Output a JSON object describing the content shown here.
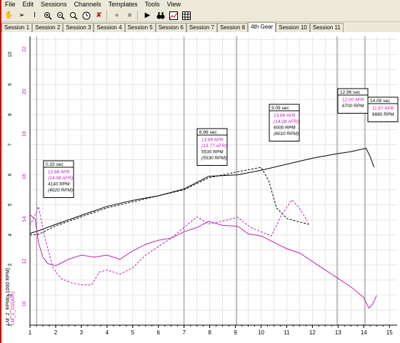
{
  "menu": [
    "File",
    "Edit",
    "Sessions",
    "Channels",
    "Templates",
    "Tools",
    "View"
  ],
  "toolbar": {
    "icons": [
      "hand-icon",
      "cursor-icon",
      "text-cursor-icon",
      "zoom-in-icon",
      "zoom-out-icon",
      "zoom-reset-icon",
      "clock-icon",
      "overlay-icon",
      "record-icon",
      "stop-icon",
      "play-icon",
      "binoculars-icon",
      "chart-icon",
      "grid-icon"
    ]
  },
  "tabs": [
    "Session 1",
    "Session 2",
    "Session 3",
    "Session 4",
    "Session 5",
    "Session 6",
    "Session 7",
    "Session 8",
    "4th Gear",
    "Session 10",
    "Session 11"
  ],
  "active_tab": "4th Gear",
  "colors": {
    "rpm": "#000000",
    "afr": "#c020b8",
    "grid": "#e4e4e4",
    "gridMajor": "#8c8c8c"
  },
  "chart_data": {
    "type": "line",
    "xlabel": "",
    "xlim": [
      1,
      15.3
    ],
    "x_ticks": [
      "1",
      "2",
      "3",
      "4",
      "5",
      "6",
      "7",
      "8",
      "9",
      "10",
      "11",
      "12",
      "13",
      "14",
      "15"
    ],
    "y_axis_labels": [
      "LM_2_RPM(x 1000 RPM)",
      "LM_2_O2(A/R)"
    ],
    "rpm_axis": {
      "range": [
        1,
        10.6
      ],
      "ticks": [
        "1",
        "2",
        "3",
        "4",
        "5",
        "6",
        "7",
        "8",
        "9",
        "10"
      ]
    },
    "afr_axis": {
      "range": [
        9,
        22.6
      ],
      "ticks": [
        "10",
        "12",
        "14",
        "16",
        "18",
        "20",
        "22"
      ]
    },
    "major_x_lines": [
      1.26,
      7.0,
      9.05,
      12.96,
      14.05
    ],
    "series": [
      {
        "name": "",
        "axis": "rpm",
        "style": "solid",
        "color": "#000000",
        "x": [
          1,
          1.33,
          2,
          3,
          4,
          5,
          6,
          7,
          7.96,
          9.09,
          10,
          11,
          12,
          12.96,
          13.5,
          14.09,
          14.25,
          14.4
        ],
        "y": [
          4.05,
          4.14,
          4.35,
          4.65,
          4.95,
          5.15,
          5.3,
          5.53,
          5.95,
          6.0,
          6.15,
          6.35,
          6.55,
          6.7,
          6.77,
          6.88,
          6.6,
          6.25
        ]
      },
      {
        "name": "",
        "axis": "rpm",
        "style": "dashed",
        "color": "#000000",
        "x": [
          1,
          1.33,
          2,
          3,
          4,
          5,
          6,
          7,
          7.96,
          9.09,
          10,
          10.3,
          10.6,
          11,
          11.4,
          11.9
        ],
        "y": [
          4.0,
          4.02,
          4.3,
          4.6,
          4.9,
          5.1,
          5.3,
          5.5,
          5.9,
          6.1,
          6.25,
          5.8,
          4.9,
          4.55,
          4.45,
          4.35
        ]
      },
      {
        "name": "",
        "axis": "afr",
        "style": "solid",
        "color": "#c020b8",
        "x": [
          1,
          1.2,
          1.33,
          1.5,
          1.7,
          2,
          2.5,
          3,
          3.5,
          4,
          4.5,
          5,
          5.5,
          6,
          6.5,
          7,
          7.5,
          7.96,
          8.5,
          9.09,
          9.5,
          10,
          10.5,
          11,
          11.5,
          12,
          12.5,
          13,
          13.5,
          14,
          14.2,
          14.35,
          14.5
        ],
        "y": [
          14.2,
          14.0,
          12.88,
          12.2,
          11.9,
          11.8,
          12.1,
          12.3,
          12.2,
          12.3,
          12.1,
          12.5,
          12.8,
          13.0,
          13.1,
          13.4,
          13.6,
          13.89,
          13.7,
          13.66,
          13.3,
          13.2,
          12.9,
          12.6,
          12.4,
          12.0,
          11.6,
          11.2,
          10.8,
          10.3,
          9.8,
          10.0,
          10.4
        ]
      },
      {
        "name": "",
        "axis": "afr",
        "style": "dashed",
        "color": "#c020b8",
        "x": [
          1,
          1.2,
          1.33,
          1.6,
          1.9,
          2.2,
          2.6,
          3,
          3.4,
          3.7,
          4,
          4.5,
          5,
          5.5,
          6,
          6.5,
          7,
          7.5,
          7.96,
          8.5,
          9.09,
          9.6,
          10,
          10.4,
          10.8,
          11.2,
          11.5,
          11.8
        ],
        "y": [
          13.7,
          14.2,
          14.58,
          13.0,
          11.7,
          11.2,
          11.0,
          10.9,
          10.9,
          11.5,
          11.6,
          11.4,
          11.7,
          12.3,
          12.7,
          13.1,
          13.6,
          14.1,
          13.77,
          13.9,
          14.08,
          13.6,
          13.4,
          13.2,
          14.2,
          14.9,
          14.5,
          13.9
        ]
      }
    ]
  },
  "markers": [
    {
      "time": "0.33 sec",
      "afr1": "12.88 AFR",
      "afr2": "(14.58 AFR)",
      "rpm1": "4140 RPM",
      "rpm2": "(4020 RPM)"
    },
    {
      "time": "6.96 sec",
      "afr1": "13.89 AFR",
      "afr2": "(13.77 AFR)",
      "rpm1": "5530 RPM",
      "rpm2": "(5530 RPM)"
    },
    {
      "time": "9.09 sec",
      "afr1": "13.66 AFR",
      "afr2": "(14.08 AFR)",
      "rpm1": "6000 RPM",
      "rpm2": "(6010 RPM)"
    },
    {
      "time": "12.96 sec",
      "afr1": "12.00 AFR",
      "rpm1": "6700 RPM"
    },
    {
      "time": "14.09 sec",
      "afr1": "11.67 AFR",
      "rpm1": "6880 RPM"
    }
  ]
}
